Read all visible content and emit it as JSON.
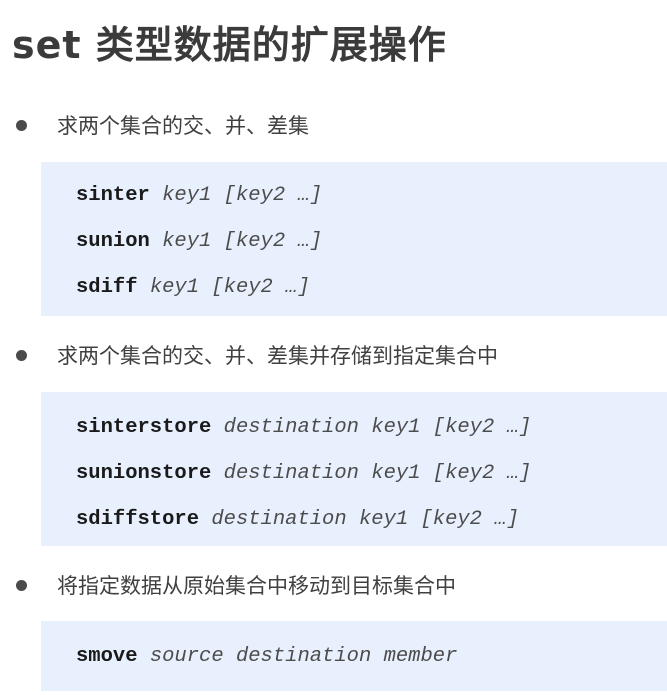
{
  "title": "set 类型数据的扩展操作",
  "sections": [
    {
      "heading": "求两个集合的交、并、差集",
      "commands": [
        {
          "cmd": "sinter",
          "args": "key1 [key2 …]"
        },
        {
          "cmd": "sunion",
          "args": "key1 [key2 …]"
        },
        {
          "cmd": "sdiff",
          "args": "key1 [key2 …]"
        }
      ]
    },
    {
      "heading": "求两个集合的交、并、差集并存储到指定集合中",
      "commands": [
        {
          "cmd": "sinterstore",
          "args": "destination key1 [key2 …]"
        },
        {
          "cmd": "sunionstore",
          "args": "destination key1 [key2 …]"
        },
        {
          "cmd": "sdiffstore",
          "args": "destination key1 [key2 …]"
        }
      ]
    },
    {
      "heading": "将指定数据从原始集合中移动到目标集合中",
      "commands": [
        {
          "cmd": "smove",
          "args": "source destination member"
        }
      ]
    }
  ],
  "colors": {
    "code_background": "#e8f0fe",
    "text": "#3a3a3a"
  }
}
